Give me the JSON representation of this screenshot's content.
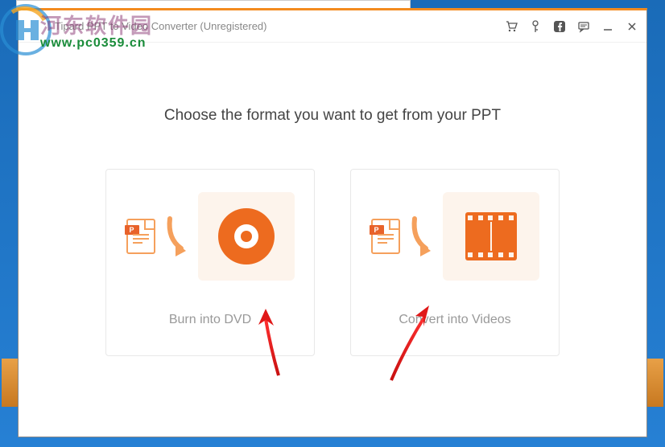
{
  "titlebar": {
    "title": "Tipard PPT to Video Converter (Unregistered)"
  },
  "content": {
    "heading": "Choose the format you want to get from your PPT"
  },
  "options": {
    "dvd": {
      "label": "Burn into DVD",
      "badge": "P"
    },
    "video": {
      "label": "Convert into Videos",
      "badge": "P"
    }
  },
  "watermark": {
    "cn_text": "河东软件园",
    "url": "www.pc0359.cn"
  }
}
